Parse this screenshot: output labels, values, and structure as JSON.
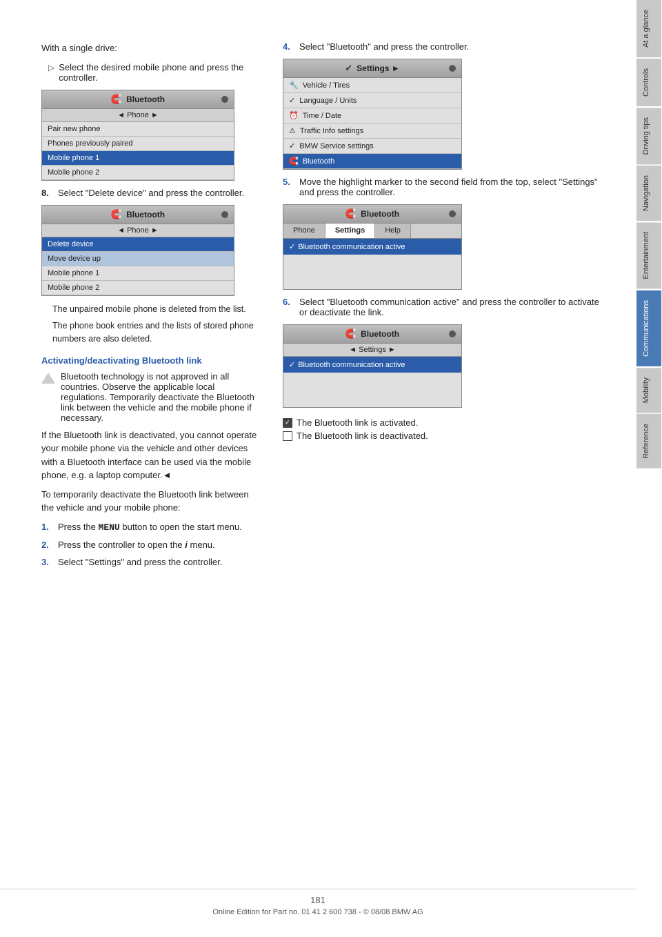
{
  "page": {
    "number": "181",
    "footer_text": "Online Edition for Part no. 01 41 2 600 738 - © 08/08 BMW AG"
  },
  "sidebar": {
    "tabs": [
      {
        "label": "At a glance",
        "active": false
      },
      {
        "label": "Controls",
        "active": false
      },
      {
        "label": "Driving tips",
        "active": false
      },
      {
        "label": "Navigation",
        "active": false
      },
      {
        "label": "Entertainment",
        "active": false
      },
      {
        "label": "Communications",
        "active": true
      },
      {
        "label": "Mobility",
        "active": false
      },
      {
        "label": "Reference",
        "active": false
      }
    ]
  },
  "left_column": {
    "intro": "With a single drive:",
    "bullet": "Select the desired mobile phone and press the controller.",
    "screen1": {
      "title": "Bluetooth",
      "nav": "◄ Phone ►",
      "items": [
        {
          "text": "Pair new phone",
          "highlighted": false
        },
        {
          "text": "Phones previously paired",
          "highlighted": false
        },
        {
          "text": "Mobile phone 1",
          "highlighted": true
        },
        {
          "text": "Mobile phone 2",
          "highlighted": false
        }
      ]
    },
    "step8": {
      "num": "8.",
      "text": "Select \"Delete device\" and press the controller."
    },
    "screen2": {
      "title": "Bluetooth",
      "nav": "◄ Phone ►",
      "items": [
        {
          "text": "Delete device",
          "highlighted": true
        },
        {
          "text": "Move device up",
          "highlighted": false
        },
        {
          "text": "Mobile phone 1",
          "highlighted": false
        },
        {
          "text": "Mobile phone 2",
          "highlighted": false
        }
      ]
    },
    "note1": "The unpaired mobile phone is deleted from the list.",
    "note2": "The phone book entries and the lists of stored phone numbers are also deleted.",
    "section_heading": "Activating/deactivating Bluetooth link",
    "warning": "Bluetooth technology is not approved in all countries. Observe the applicable local regulations. Temporarily deactivate the Bluetooth link between the vehicle and the mobile phone if necessary.",
    "para1": "If the Bluetooth link is deactivated, you cannot operate your mobile phone via the vehicle and other devices with a Bluetooth interface can be used via the mobile phone, e.g. a laptop computer.◄",
    "para2": "To temporarily deactivate the Bluetooth link between the vehicle and your mobile phone:",
    "steps": [
      {
        "num": "1.",
        "text": "Press the MENU button to open the start menu."
      },
      {
        "num": "2.",
        "text": "Press the controller to open the i menu."
      },
      {
        "num": "3.",
        "text": "Select \"Settings\" and press the controller."
      }
    ]
  },
  "right_column": {
    "step4": {
      "num": "4.",
      "text": "Select \"Bluetooth\" and press the controller."
    },
    "screen3": {
      "title": "Settings ►",
      "items": [
        {
          "icon": "vehicle",
          "text": "Vehicle / Tires",
          "highlighted": false
        },
        {
          "icon": "language",
          "text": "Language / Units",
          "highlighted": false
        },
        {
          "icon": "time",
          "text": "Time / Date",
          "highlighted": false
        },
        {
          "icon": "traffic",
          "text": "Traffic Info settings",
          "highlighted": false
        },
        {
          "icon": "bmw",
          "text": "BMW Service settings",
          "highlighted": false
        },
        {
          "icon": "bt",
          "text": "Bluetooth",
          "highlighted": true
        }
      ]
    },
    "step5": {
      "num": "5.",
      "text": "Move the highlight marker to the second field from the top, select \"Settings\" and press the controller."
    },
    "screen4": {
      "title": "Bluetooth",
      "tabs": [
        {
          "label": "Phone",
          "active": false
        },
        {
          "label": "Settings",
          "active": true
        },
        {
          "label": "Help",
          "active": false
        }
      ],
      "row": "✓ Bluetooth communication active"
    },
    "step6": {
      "num": "6.",
      "text": "Select \"Bluetooth communication active\" and press the controller to activate or deactivate the link."
    },
    "screen5": {
      "title": "Bluetooth",
      "nav": "◄ Settings ►",
      "row": "✓ Bluetooth communication active"
    },
    "legend": [
      {
        "checked": true,
        "text": "The Bluetooth link is activated."
      },
      {
        "checked": false,
        "text": "The Bluetooth link is deactivated."
      }
    ]
  }
}
